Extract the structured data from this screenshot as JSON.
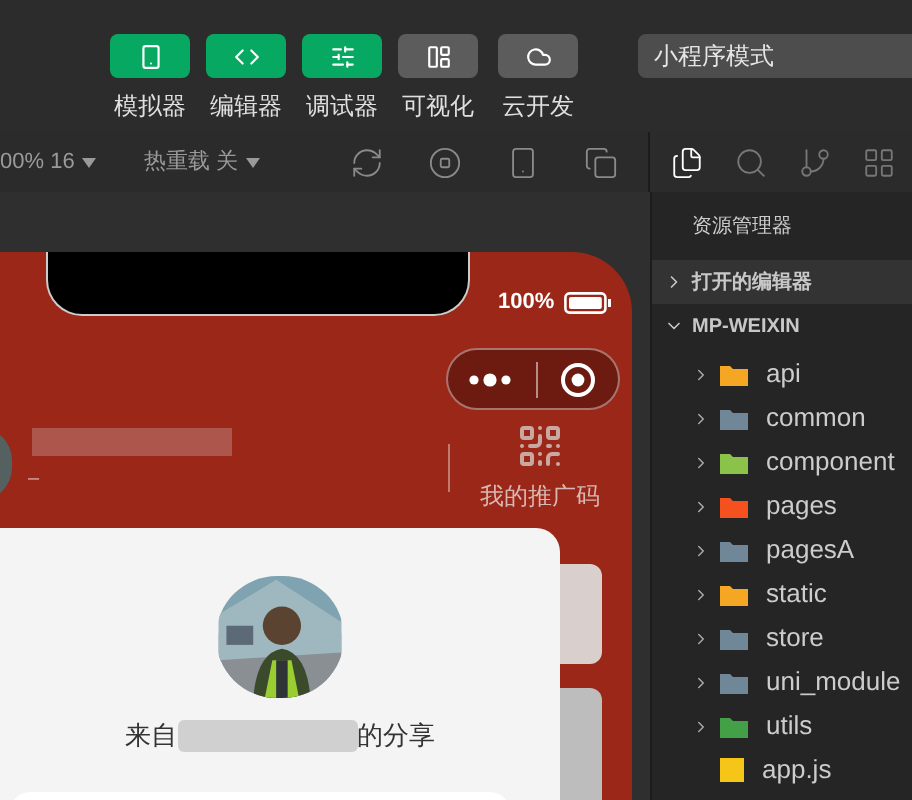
{
  "toolbar": {
    "buttons": [
      {
        "label": "模拟器",
        "active": true
      },
      {
        "label": "编辑器",
        "active": true
      },
      {
        "label": "调试器",
        "active": true
      },
      {
        "label": "可视化",
        "active": false
      },
      {
        "label": "云开发",
        "active": false
      }
    ],
    "mode_select": {
      "value": "小程序模式"
    }
  },
  "sim_bar": {
    "zoom": "00% 16",
    "hot_reload": "热重载 关"
  },
  "sidebar_tabs": [
    {
      "selected": true
    },
    {
      "selected": false
    },
    {
      "selected": false
    },
    {
      "selected": false
    }
  ],
  "phone": {
    "battery": "100%",
    "name_sub": "–",
    "promo": "我的推广码",
    "share_prefix": "来自",
    "share_suffix": "的分享"
  },
  "explorer": {
    "title": "资源管理器",
    "sections": [
      {
        "label": "打开的编辑器",
        "expanded": false
      },
      {
        "label": "MP-WEIXIN",
        "expanded": true
      }
    ],
    "items": [
      {
        "kind": "folder",
        "name": "api",
        "color": "#f5a623"
      },
      {
        "kind": "folder",
        "name": "common",
        "color": "#6f8796"
      },
      {
        "kind": "folder",
        "name": "component",
        "color": "#8bc34a"
      },
      {
        "kind": "folder",
        "name": "pages",
        "color": "#f4511e"
      },
      {
        "kind": "folder",
        "name": "pagesA",
        "color": "#6f8796"
      },
      {
        "kind": "folder",
        "name": "static",
        "color": "#f5a623"
      },
      {
        "kind": "folder",
        "name": "store",
        "color": "#6f8796"
      },
      {
        "kind": "folder",
        "name": "uni_module",
        "color": "#6f8796"
      },
      {
        "kind": "folder",
        "name": "utils",
        "color": "#43a047"
      },
      {
        "kind": "file",
        "name": "app.js",
        "color": "#f5c518"
      }
    ]
  }
}
